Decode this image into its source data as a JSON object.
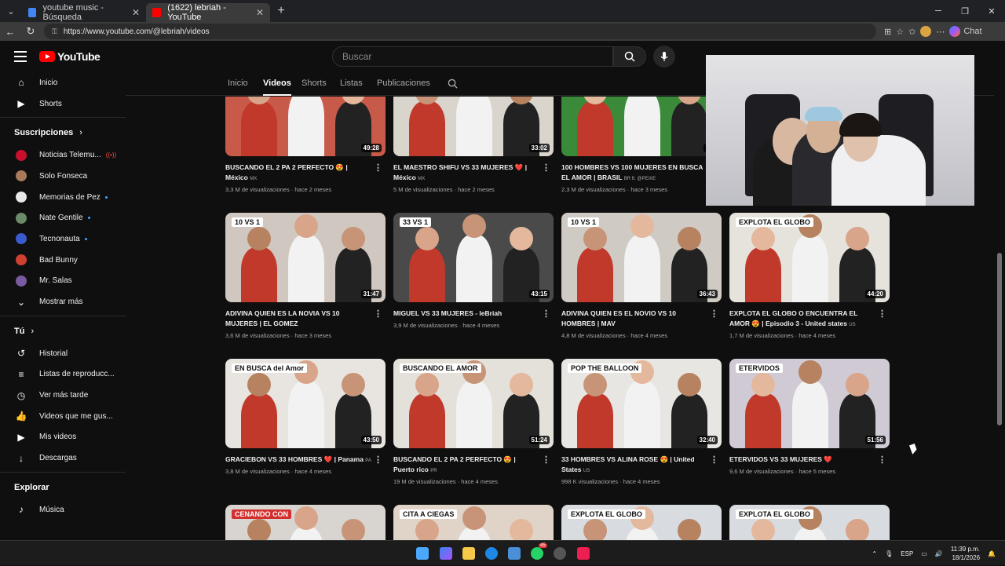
{
  "browser": {
    "tabs": [
      {
        "title": "youtube music - Búsqueda",
        "favicon_color": "#4285f4"
      },
      {
        "title": "(1622) lebriah - YouTube",
        "favicon_color": "#ff0000"
      }
    ],
    "url": "https://www.youtube.com/@lebriah/videos",
    "chat_label": "Chat"
  },
  "masthead": {
    "logo_text": "YouTube",
    "search_placeholder": "Buscar"
  },
  "sidebar": {
    "main": [
      {
        "label": "Inicio",
        "icon": "home-icon",
        "glyph": "⌂"
      },
      {
        "label": "Shorts",
        "icon": "shorts-icon",
        "glyph": "▶"
      }
    ],
    "subscriptions_title": "Suscripciones",
    "subscriptions": [
      {
        "label": "Noticias Telemu...",
        "color": "#c8102e",
        "badge": "live"
      },
      {
        "label": "Solo Fonseca",
        "color": "#a87a5a",
        "badge": ""
      },
      {
        "label": "Memorias de Pez",
        "color": "#e8e8e8",
        "badge": "dot"
      },
      {
        "label": "Nate Gentile",
        "color": "#6a8a6a",
        "badge": "dot"
      },
      {
        "label": "Tecnonauta",
        "color": "#3a5ad0",
        "badge": "dot"
      },
      {
        "label": "Bad Bunny",
        "color": "#d04030",
        "badge": ""
      },
      {
        "label": "Mr. Salas",
        "color": "#7a5aa0",
        "badge": ""
      }
    ],
    "show_more": "Mostrar más",
    "you_title": "Tú",
    "you_items": [
      {
        "label": "Historial",
        "icon": "history-icon",
        "glyph": "↺"
      },
      {
        "label": "Listas de reproducc...",
        "icon": "playlists-icon",
        "glyph": "≡"
      },
      {
        "label": "Ver más tarde",
        "icon": "watch-later-icon",
        "glyph": "◷"
      },
      {
        "label": "Videos que me gus...",
        "icon": "liked-videos-icon",
        "glyph": "👍"
      },
      {
        "label": "Mis videos",
        "icon": "my-videos-icon",
        "glyph": "▶"
      },
      {
        "label": "Descargas",
        "icon": "downloads-icon",
        "glyph": "↓"
      }
    ],
    "explore_title": "Explorar",
    "explore_items": [
      {
        "label": "Música",
        "icon": "music-icon",
        "glyph": "♪"
      }
    ]
  },
  "channel_tabs": [
    "Inicio",
    "Videos",
    "Shorts",
    "Listas",
    "Publicaciones"
  ],
  "videos": [
    {
      "title": "BUSCANDO EL 2 PA 2 PERFECTO 😍 |",
      "title2": "México",
      "cc": "MX",
      "meta": "3,3 M de visualizaciones · hace 2 meses",
      "duration": "49:28",
      "bg": "#c85a4a",
      "banner": "",
      "banner_bg": ""
    },
    {
      "title": "EL MAESTRO SHIFU VS 33 MUJERES ❤️ |",
      "title2": "México",
      "cc": "MX",
      "meta": "5 M de visualizaciones · hace 2 meses",
      "duration": "33:02",
      "bg": "#d9d4cc",
      "banner": "",
      "banner_bg": ""
    },
    {
      "title": "100 HOMBRES VS 100 MUJERES EN BUSCA",
      "title2": "EL AMOR | BRASIL",
      "cc": "BR ft. @PEIXE",
      "meta": "2,3 M de visualizaciones · hace 3 meses",
      "duration": "37:",
      "bg": "#3a8a3a",
      "banner": "",
      "banner_bg": ""
    },
    {
      "title": "ADIVINA QUIEN ES LA NOVIA VS 10",
      "title2": "MUJERES | EL GOMEZ",
      "cc": "",
      "meta": "3,6 M de visualizaciones · hace 3 meses",
      "duration": "31:47",
      "bg": "#d0c8c0",
      "banner": "10 VS 1",
      "banner_bg": "#ffffff"
    },
    {
      "title": "MIGUEL VS 33 MUJERES - leBriah",
      "title2": "",
      "cc": "",
      "meta": "3,9 M de visualizaciones · hace 4 meses",
      "duration": "43:15",
      "bg": "#4a4a4a",
      "banner": "33 VS 1",
      "banner_bg": "#ffffff"
    },
    {
      "title": "ADIVINA QUIEN ES EL NOVIO VS 10",
      "title2": "HOMBRES | MAV",
      "cc": "",
      "meta": "4,8 M de visualizaciones · hace 4 meses",
      "duration": "36:43",
      "bg": "#cfcac4",
      "banner": "10 VS 1",
      "banner_bg": "#ffffff"
    },
    {
      "title": "EXPLOTA EL GLOBO O ENCUENTRA EL",
      "title2": "AMOR 😍 | Episodio 3 - United states",
      "cc": "US",
      "meta": "1,7 M de visualizaciones · hace 4 meses",
      "duration": "44:20",
      "bg": "#e6e2dc",
      "banner": "EXPLOTA EL GLOBO",
      "banner_bg": "#ffffff"
    },
    {
      "title": "GRACIEBON VS 33 HOMBRES ❤️ | Panama",
      "title2": "",
      "cc": "PA",
      "meta": "3,8 M de visualizaciones · hace 4 meses",
      "duration": "43:50",
      "bg": "#e8e4e0",
      "banner": "EN BUSCA del Amor",
      "banner_bg": "#ffffff"
    },
    {
      "title": "BUSCANDO EL 2 PA 2 PERFECTO 😍 |",
      "title2": "Puerto rico",
      "cc": "PR",
      "meta": "19 M de visualizaciones · hace 4 meses",
      "duration": "51:24",
      "bg": "#e4e0da",
      "banner": "BUSCANDO EL AMOR",
      "banner_bg": "#ffffff"
    },
    {
      "title": "33 HOMBRES VS ALINA ROSE 😍 | United",
      "title2": "States",
      "cc": "US",
      "meta": "998 K visualizaciones · hace 4 meses",
      "duration": "32:40",
      "bg": "#e8e6e2",
      "banner": "POP THE BALLOON",
      "banner_bg": "#ffffff"
    },
    {
      "title": "ETERVIDOS VS 33 MUJERES ❤️",
      "title2": "",
      "cc": "",
      "meta": "9,6 M de visualizaciones · hace 5 meses",
      "duration": "51:56",
      "bg": "#cfcad4",
      "banner": "ETERVIDOS",
      "banner_bg": "#ffffff"
    },
    {
      "title": "",
      "title2": "",
      "cc": "",
      "meta": "",
      "duration": "",
      "bg": "#d8d4d0",
      "banner": "CENANDO CON",
      "banner_bg": "#d32f2f"
    },
    {
      "title": "",
      "title2": "",
      "cc": "",
      "meta": "",
      "duration": "",
      "bg": "#e0d4c8",
      "banner": "CITA A CIEGAS",
      "banner_bg": "#ffffff"
    },
    {
      "title": "",
      "title2": "",
      "cc": "",
      "meta": "",
      "duration": "",
      "bg": "#d8dce0",
      "banner": "EXPLOTA EL GLOBO",
      "banner_bg": "#ffffff"
    },
    {
      "title": "",
      "title2": "",
      "cc": "",
      "meta": "",
      "duration": "",
      "bg": "#d8dce0",
      "banner": "EXPLOTA EL GLOBO",
      "banner_bg": "#ffffff"
    }
  ],
  "taskbar": {
    "lang": "ESP",
    "time": "11:39 p.m.",
    "date": "18/1/2026",
    "badge_count": "45"
  }
}
